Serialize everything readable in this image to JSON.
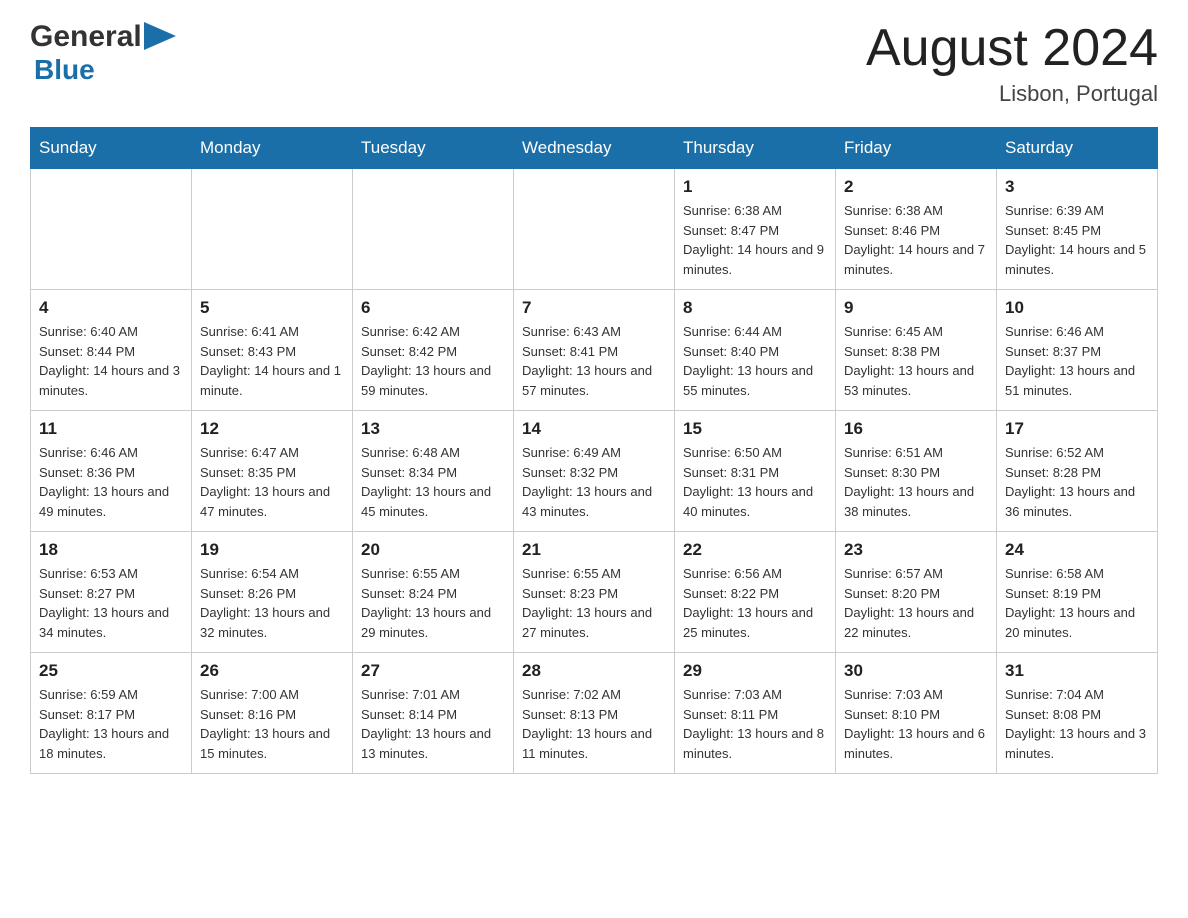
{
  "header": {
    "logo_general": "General",
    "logo_blue": "Blue",
    "month_title": "August 2024",
    "location": "Lisbon, Portugal"
  },
  "weekdays": [
    "Sunday",
    "Monday",
    "Tuesday",
    "Wednesday",
    "Thursday",
    "Friday",
    "Saturday"
  ],
  "weeks": [
    [
      {
        "day": "",
        "sunrise": "",
        "sunset": "",
        "daylight": ""
      },
      {
        "day": "",
        "sunrise": "",
        "sunset": "",
        "daylight": ""
      },
      {
        "day": "",
        "sunrise": "",
        "sunset": "",
        "daylight": ""
      },
      {
        "day": "",
        "sunrise": "",
        "sunset": "",
        "daylight": ""
      },
      {
        "day": "1",
        "sunrise": "Sunrise: 6:38 AM",
        "sunset": "Sunset: 8:47 PM",
        "daylight": "Daylight: 14 hours and 9 minutes."
      },
      {
        "day": "2",
        "sunrise": "Sunrise: 6:38 AM",
        "sunset": "Sunset: 8:46 PM",
        "daylight": "Daylight: 14 hours and 7 minutes."
      },
      {
        "day": "3",
        "sunrise": "Sunrise: 6:39 AM",
        "sunset": "Sunset: 8:45 PM",
        "daylight": "Daylight: 14 hours and 5 minutes."
      }
    ],
    [
      {
        "day": "4",
        "sunrise": "Sunrise: 6:40 AM",
        "sunset": "Sunset: 8:44 PM",
        "daylight": "Daylight: 14 hours and 3 minutes."
      },
      {
        "day": "5",
        "sunrise": "Sunrise: 6:41 AM",
        "sunset": "Sunset: 8:43 PM",
        "daylight": "Daylight: 14 hours and 1 minute."
      },
      {
        "day": "6",
        "sunrise": "Sunrise: 6:42 AM",
        "sunset": "Sunset: 8:42 PM",
        "daylight": "Daylight: 13 hours and 59 minutes."
      },
      {
        "day": "7",
        "sunrise": "Sunrise: 6:43 AM",
        "sunset": "Sunset: 8:41 PM",
        "daylight": "Daylight: 13 hours and 57 minutes."
      },
      {
        "day": "8",
        "sunrise": "Sunrise: 6:44 AM",
        "sunset": "Sunset: 8:40 PM",
        "daylight": "Daylight: 13 hours and 55 minutes."
      },
      {
        "day": "9",
        "sunrise": "Sunrise: 6:45 AM",
        "sunset": "Sunset: 8:38 PM",
        "daylight": "Daylight: 13 hours and 53 minutes."
      },
      {
        "day": "10",
        "sunrise": "Sunrise: 6:46 AM",
        "sunset": "Sunset: 8:37 PM",
        "daylight": "Daylight: 13 hours and 51 minutes."
      }
    ],
    [
      {
        "day": "11",
        "sunrise": "Sunrise: 6:46 AM",
        "sunset": "Sunset: 8:36 PM",
        "daylight": "Daylight: 13 hours and 49 minutes."
      },
      {
        "day": "12",
        "sunrise": "Sunrise: 6:47 AM",
        "sunset": "Sunset: 8:35 PM",
        "daylight": "Daylight: 13 hours and 47 minutes."
      },
      {
        "day": "13",
        "sunrise": "Sunrise: 6:48 AM",
        "sunset": "Sunset: 8:34 PM",
        "daylight": "Daylight: 13 hours and 45 minutes."
      },
      {
        "day": "14",
        "sunrise": "Sunrise: 6:49 AM",
        "sunset": "Sunset: 8:32 PM",
        "daylight": "Daylight: 13 hours and 43 minutes."
      },
      {
        "day": "15",
        "sunrise": "Sunrise: 6:50 AM",
        "sunset": "Sunset: 8:31 PM",
        "daylight": "Daylight: 13 hours and 40 minutes."
      },
      {
        "day": "16",
        "sunrise": "Sunrise: 6:51 AM",
        "sunset": "Sunset: 8:30 PM",
        "daylight": "Daylight: 13 hours and 38 minutes."
      },
      {
        "day": "17",
        "sunrise": "Sunrise: 6:52 AM",
        "sunset": "Sunset: 8:28 PM",
        "daylight": "Daylight: 13 hours and 36 minutes."
      }
    ],
    [
      {
        "day": "18",
        "sunrise": "Sunrise: 6:53 AM",
        "sunset": "Sunset: 8:27 PM",
        "daylight": "Daylight: 13 hours and 34 minutes."
      },
      {
        "day": "19",
        "sunrise": "Sunrise: 6:54 AM",
        "sunset": "Sunset: 8:26 PM",
        "daylight": "Daylight: 13 hours and 32 minutes."
      },
      {
        "day": "20",
        "sunrise": "Sunrise: 6:55 AM",
        "sunset": "Sunset: 8:24 PM",
        "daylight": "Daylight: 13 hours and 29 minutes."
      },
      {
        "day": "21",
        "sunrise": "Sunrise: 6:55 AM",
        "sunset": "Sunset: 8:23 PM",
        "daylight": "Daylight: 13 hours and 27 minutes."
      },
      {
        "day": "22",
        "sunrise": "Sunrise: 6:56 AM",
        "sunset": "Sunset: 8:22 PM",
        "daylight": "Daylight: 13 hours and 25 minutes."
      },
      {
        "day": "23",
        "sunrise": "Sunrise: 6:57 AM",
        "sunset": "Sunset: 8:20 PM",
        "daylight": "Daylight: 13 hours and 22 minutes."
      },
      {
        "day": "24",
        "sunrise": "Sunrise: 6:58 AM",
        "sunset": "Sunset: 8:19 PM",
        "daylight": "Daylight: 13 hours and 20 minutes."
      }
    ],
    [
      {
        "day": "25",
        "sunrise": "Sunrise: 6:59 AM",
        "sunset": "Sunset: 8:17 PM",
        "daylight": "Daylight: 13 hours and 18 minutes."
      },
      {
        "day": "26",
        "sunrise": "Sunrise: 7:00 AM",
        "sunset": "Sunset: 8:16 PM",
        "daylight": "Daylight: 13 hours and 15 minutes."
      },
      {
        "day": "27",
        "sunrise": "Sunrise: 7:01 AM",
        "sunset": "Sunset: 8:14 PM",
        "daylight": "Daylight: 13 hours and 13 minutes."
      },
      {
        "day": "28",
        "sunrise": "Sunrise: 7:02 AM",
        "sunset": "Sunset: 8:13 PM",
        "daylight": "Daylight: 13 hours and 11 minutes."
      },
      {
        "day": "29",
        "sunrise": "Sunrise: 7:03 AM",
        "sunset": "Sunset: 8:11 PM",
        "daylight": "Daylight: 13 hours and 8 minutes."
      },
      {
        "day": "30",
        "sunrise": "Sunrise: 7:03 AM",
        "sunset": "Sunset: 8:10 PM",
        "daylight": "Daylight: 13 hours and 6 minutes."
      },
      {
        "day": "31",
        "sunrise": "Sunrise: 7:04 AM",
        "sunset": "Sunset: 8:08 PM",
        "daylight": "Daylight: 13 hours and 3 minutes."
      }
    ]
  ]
}
